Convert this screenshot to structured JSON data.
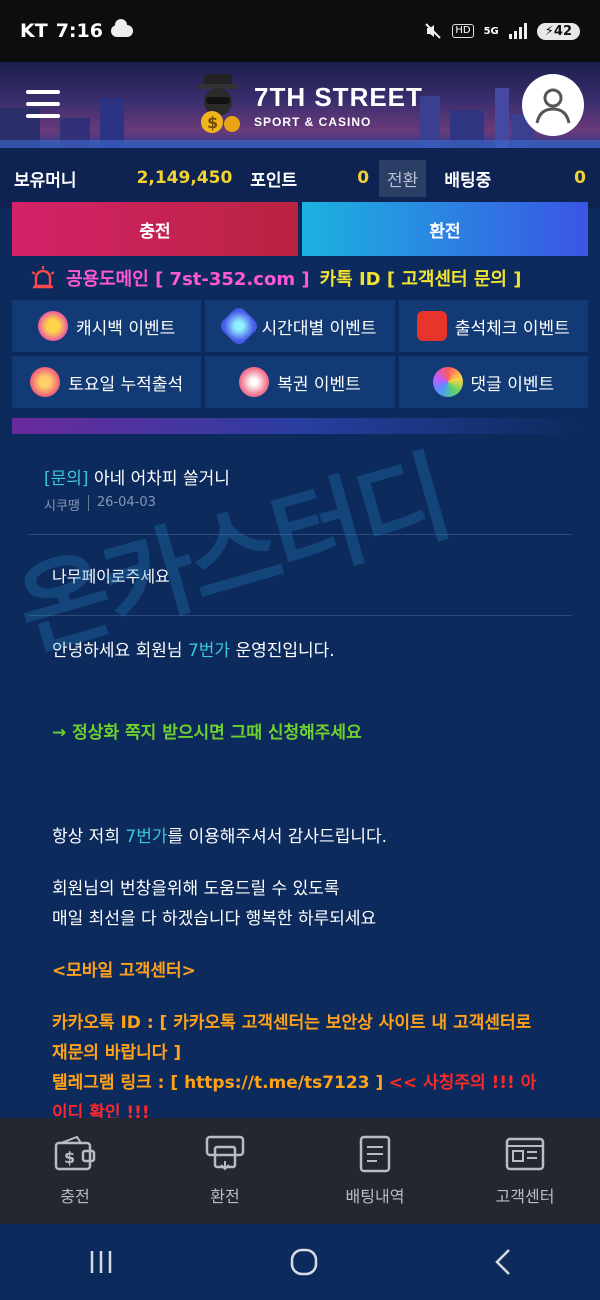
{
  "status_bar": {
    "carrier": "KT",
    "time": "7:16",
    "hd": "HD",
    "net": "5G",
    "battery": "42"
  },
  "header": {
    "brand": "7TH STREET",
    "tagline": "SPORT & CASINO"
  },
  "balance": {
    "money_label": "보유머니",
    "money_value": "2,149,450",
    "point_label": "포인트",
    "point_value": "0",
    "switch_label": "전환",
    "betting_label": "배팅중",
    "betting_value": "0"
  },
  "actions": {
    "charge": "충전",
    "exchange": "환전"
  },
  "notice": {
    "part1": "공용도메인 [ 7st-352.com ]",
    "part2": "카톡 ID [ 고객센터 문의 ]"
  },
  "events": [
    {
      "label": "캐시백 이벤트",
      "icon": "cashback-icon"
    },
    {
      "label": "시간대별 이벤트",
      "icon": "time-icon"
    },
    {
      "label": "출석체크 이벤트",
      "icon": "dice-icon"
    },
    {
      "label": "토요일 누적출석",
      "icon": "saturday-icon"
    },
    {
      "label": "복권 이벤트",
      "icon": "lottery-icon"
    },
    {
      "label": "댓글 이벤트",
      "icon": "comment-icon"
    }
  ],
  "message": {
    "tag": "[문의]",
    "title": "아네 어차피 쓸거니",
    "author": "시쿠땡",
    "date": "26-04-03",
    "question": "나무페이로주세요",
    "greeting_pre": "안녕하세요 회원님 ",
    "greeting_brand": "7번가",
    "greeting_post": " 운영진입니다.",
    "arrow_line": "→ 정상화 쪽지 받으시면 그때 신청해주세요",
    "thanks_pre": "항상 저희 ",
    "thanks_brand": "7번가",
    "thanks_post": "를 이용해주셔서 감사드립니다.",
    "wish_line1": "회원님의 번창을위해 도움드릴 수 있도록",
    "wish_line2": "매일 최선을 다 하겠습니다 행복한 하루되세요",
    "mobile_center": "<모바일 고객센터>",
    "kakao": "카카오톡 ID : [ 카카오톡 고객센터는 보안상 사이트 내 고객센터로 재문의 바랍니다 ]",
    "telegram": "텔레그램 링크 : [ https://t.me/ts7123 ]",
    "warning": "<< 사칭주의 !!! 아이디 확인 !!!"
  },
  "watermark": "온카스터디",
  "bottom_nav": [
    {
      "label": "충전",
      "icon": "wallet-icon"
    },
    {
      "label": "환전",
      "icon": "atm-icon"
    },
    {
      "label": "배팅내역",
      "icon": "list-icon"
    },
    {
      "label": "고객센터",
      "icon": "news-icon"
    }
  ],
  "colors": {
    "accent_yellow": "#f2d233",
    "teal": "#3ec7d8",
    "green": "#6fd12e",
    "orange": "#ffa21a",
    "red": "#ff2828",
    "pink": "#ff58d6"
  }
}
